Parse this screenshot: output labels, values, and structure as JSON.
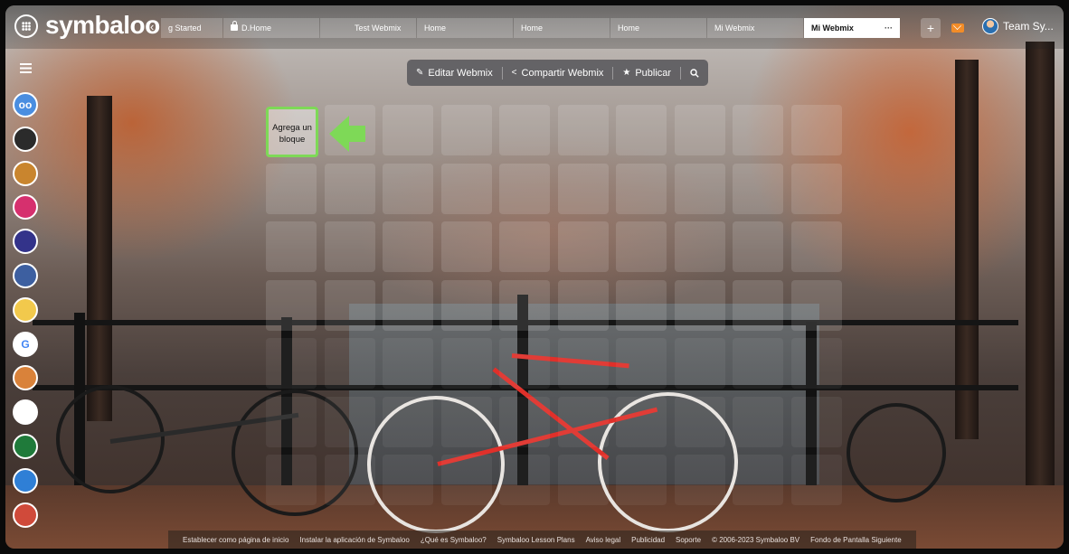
{
  "app": {
    "logo": "symbaloo"
  },
  "tabs": [
    {
      "label": "g Started",
      "locked": false
    },
    {
      "label": "D.Home",
      "locked": true
    },
    {
      "label": "Test Webmix",
      "locked": false
    },
    {
      "label": "Home",
      "locked": false
    },
    {
      "label": "Home",
      "locked": false
    },
    {
      "label": "Home",
      "locked": false
    },
    {
      "label": "Mi Webmix",
      "locked": false
    },
    {
      "label": "Mi Webmix",
      "active": true,
      "more": "···"
    }
  ],
  "header": {
    "add_tab": "+",
    "account_name": "Team Sy..."
  },
  "toolbar": {
    "edit_label": "Editar Webmix",
    "share_label": "Compartir Webmix",
    "publish_label": "Publicar"
  },
  "grid": {
    "add_tile_label": "Agrega un bloque"
  },
  "sidebar": {
    "items": [
      {
        "icon": "owl-app-icon",
        "color": "#4a8ee0",
        "glyph": "oo"
      },
      {
        "icon": "cat-app-icon",
        "color": "#2b2b2b",
        "glyph": ""
      },
      {
        "icon": "lion-app-icon",
        "color": "#c9852e",
        "glyph": ""
      },
      {
        "icon": "classroom-app-icon",
        "color": "#d6306e",
        "glyph": ""
      },
      {
        "icon": "symbaloo-apps-icon",
        "color": "#33338a",
        "glyph": ""
      },
      {
        "icon": "students-app-icon",
        "color": "#3d5fa0",
        "glyph": ""
      },
      {
        "icon": "gamepad-app-icon",
        "color": "#f2c94c",
        "glyph": ""
      },
      {
        "icon": "google-icon",
        "color": "#ffffff",
        "glyph": "G"
      },
      {
        "icon": "food-app-icon",
        "color": "#d9823a",
        "glyph": ""
      },
      {
        "icon": "windows-icon",
        "color": "#ffffff",
        "glyph": ""
      },
      {
        "icon": "code-app-icon",
        "color": "#1f7a3a",
        "glyph": ""
      },
      {
        "icon": "bag-app-icon",
        "color": "#2f7fd6",
        "glyph": ""
      },
      {
        "icon": "maps-app-icon",
        "color": "#d04a3a",
        "glyph": ""
      }
    ]
  },
  "footer": {
    "links": [
      "Establecer como página de inicio",
      "Instalar la aplicación de Symbaloo",
      "¿Qué es Symbaloo?",
      "Symbaloo Lesson Plans",
      "Aviso legal",
      "Publicidad",
      "Soporte",
      "© 2006-2023 Symbaloo BV",
      "Fondo de Pantalla Siguiente"
    ]
  },
  "colors": {
    "accent_green": "#7ed957",
    "mail_orange": "#f28c28",
    "bike_red": "#e0302a"
  }
}
